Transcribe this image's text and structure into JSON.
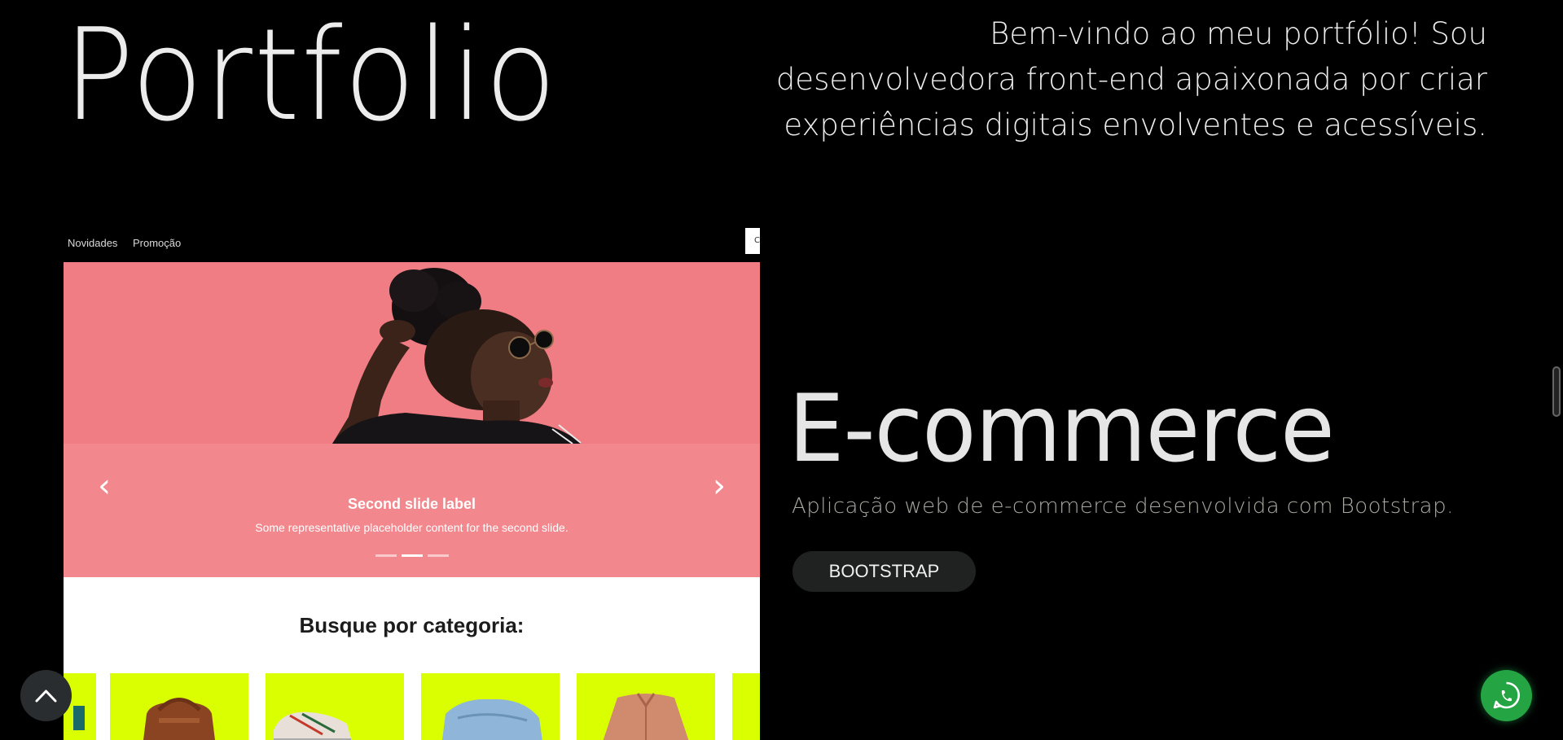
{
  "header": {
    "title": "Portfolio",
    "intro": "Bem-vindo ao meu portfólio! Sou desenvolvedora front-end apaixonada por criar experiências digitais envolventes e acessíveis."
  },
  "preview": {
    "nav": {
      "links": [
        "Novidades",
        "Promoção"
      ],
      "box_glyph": "C"
    },
    "carousel": {
      "prev_glyph": "‹",
      "next_glyph": "›",
      "caption_title": "Second slide label",
      "caption_text": "Some representative placeholder content for the second slide.",
      "indicator_count": 3,
      "active_indicator": 2
    },
    "categories": {
      "heading": "Busque por categoria:",
      "items": [
        "partial",
        "bag",
        "sneaker",
        "jeans",
        "jacket",
        "partial"
      ]
    }
  },
  "project": {
    "title": "E-commerce",
    "description": "Aplicação web de e-commerce desenvolvida com Bootstrap.",
    "tech": "BOOTSTRAP"
  },
  "colors": {
    "background": "#000000",
    "text_primary": "#ececec",
    "text_muted": "#a8a8a0",
    "carousel_pink": "#f2888e",
    "category_lime": "#d9ff00",
    "badge_bg": "#202222",
    "whatsapp_green": "#25a444"
  },
  "icons": {
    "back_to_top": "chevron-up-icon",
    "whatsapp": "whatsapp-icon"
  }
}
